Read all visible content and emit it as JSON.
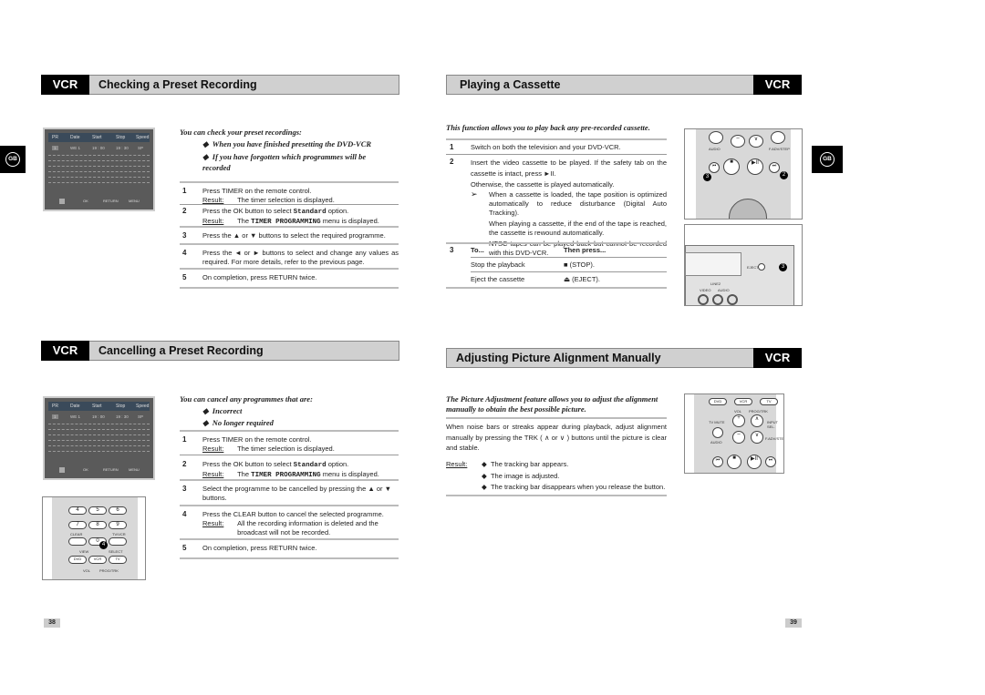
{
  "left_page": {
    "page_number": "38",
    "side_badge": "GB",
    "section1": {
      "tag": "VCR",
      "title": "Checking a Preset Recording",
      "intro": "You can check your preset recordings:",
      "bullets": [
        "When you have finished presetting the DVD-VCR",
        "If you have forgotten which programmes will be recorded"
      ],
      "steps": [
        {
          "num": "1",
          "text": "Press TIMER on the remote control.",
          "result_label": "Result:",
          "result": "The timer selection is displayed."
        },
        {
          "num": "2",
          "text_pre": "Press the OK button to select ",
          "text_code": "Standard",
          "text_post": " option.",
          "result_label": "Result:",
          "result_pre": "The ",
          "result_code": "TIMER PROGRAMMING",
          "result_post": " menu is displayed."
        },
        {
          "num": "3",
          "text": "Press the ▲ or ▼ buttons to select the required programme."
        },
        {
          "num": "4",
          "text": "Press the ◄ or ► buttons to select and change any values as required. For more details, refer to the previous page."
        },
        {
          "num": "5",
          "text": "On completion, press RETURN twice."
        }
      ],
      "screen": {
        "headers": [
          "PR",
          "Date",
          "Start",
          "Stop",
          "Speed"
        ],
        "row": [
          "1",
          "WE 1",
          "19 : 00",
          "19 : 30",
          "SP"
        ],
        "footer": [
          "OK",
          "RETURN",
          "MENU"
        ]
      }
    },
    "section2": {
      "tag": "VCR",
      "title": "Cancelling a Preset Recording",
      "intro": "You can cancel any programmes that are:",
      "bullets": [
        "Incorrect",
        "No longer required"
      ],
      "steps": [
        {
          "num": "1",
          "text": "Press TIMER on the remote control.",
          "result_label": "Result:",
          "result": "The timer selection is displayed."
        },
        {
          "num": "2",
          "text_pre": "Press the OK button to select ",
          "text_code": "Standard",
          "text_post": " option.",
          "result_label": "Result:",
          "result_pre": "The ",
          "result_code": "TIMER PROGRAMMING",
          "result_post": " menu is displayed."
        },
        {
          "num": "3",
          "text": "Select the programme to be cancelled by pressing the ▲ or ▼ buttons."
        },
        {
          "num": "4",
          "text": "Press the CLEAR button to cancel the selected programme.",
          "result_label": "Result:",
          "result": "All the recording information is deleted and the broadcast will not be recorded."
        },
        {
          "num": "5",
          "text": "On completion, press RETURN twice."
        }
      ],
      "screen": {
        "headers": [
          "PR",
          "Date",
          "Start",
          "Stop",
          "Speed"
        ],
        "row": [
          "1",
          "WE 1",
          "19 : 00",
          "19 : 30",
          "SP"
        ],
        "footer": [
          "OK",
          "RETURN",
          "MENU"
        ]
      },
      "remote": {
        "keys": [
          "4",
          "5",
          "6",
          "7",
          "8",
          "9",
          "0"
        ],
        "labels": [
          "CLEAR",
          "TV/VCR",
          "VIEW",
          "SELECT",
          "DVD",
          "VCR",
          "TV",
          "VOL",
          "PROG/TRK"
        ],
        "callout": "4"
      }
    }
  },
  "right_page": {
    "page_number": "39",
    "side_badge": "GB",
    "section1": {
      "tag": "VCR",
      "title": "Playing a Cassette",
      "intro": "This function allows you to play back any pre-recorded cassette.",
      "step1": {
        "num": "1",
        "text": "Switch on both the television and your DVD-VCR."
      },
      "step2": {
        "num": "2",
        "text": "Insert the video cassette to be played. If the safety tab on the cassette is intact, press ►II.",
        "text2": "Otherwise, the cassette is played automatically.",
        "note_marker": "➢",
        "notes": [
          "When a cassette is loaded, the tape position is optimized automatically to reduce disturbance (Digital Auto Tracking).",
          "When playing a cassette, if the end of the tape is reached, the cassette is rewound automatically.",
          "NTSC tapes can be played back but cannot be recorded with this DVD-VCR."
        ]
      },
      "step3": {
        "num": "3",
        "col1": "To...",
        "col2": "Then press...",
        "rows": [
          {
            "action": "Stop the playback",
            "press": "■ (STOP)."
          },
          {
            "action": "Eject the cassette",
            "press": "⏏ (EJECT)."
          }
        ]
      },
      "remote": {
        "labels": [
          "AUDIO",
          "F.ADV/STEP"
        ],
        "callouts": [
          "3",
          "2"
        ]
      },
      "front_panel": {
        "labels": [
          "EJECT",
          "VIDEO",
          "AUDIO",
          "LINE2"
        ],
        "callout": "3"
      }
    },
    "section2": {
      "tag": "VCR",
      "title": "Adjusting Picture Alignment Manually",
      "intro": "The Picture Adjustment feature allows you to adjust the alignment manually to obtain the best possible picture.",
      "body": "When noise bars or streaks appear during playback, adjust alignment manually by pressing the TRK ( ∧ or ∨ ) buttons until the picture is clear and stable.",
      "result_label": "Result:",
      "results": [
        "The tracking bar appears.",
        "The image is adjusted.",
        "The tracking bar disappears when you release the button."
      ],
      "remote": {
        "labels": [
          "DVD",
          "VCR",
          "TV",
          "VOL",
          "PROG/TRK",
          "TV MUTE",
          "INPUT SEL.",
          "AUDIO",
          "F.ADV/STEP"
        ]
      }
    }
  }
}
